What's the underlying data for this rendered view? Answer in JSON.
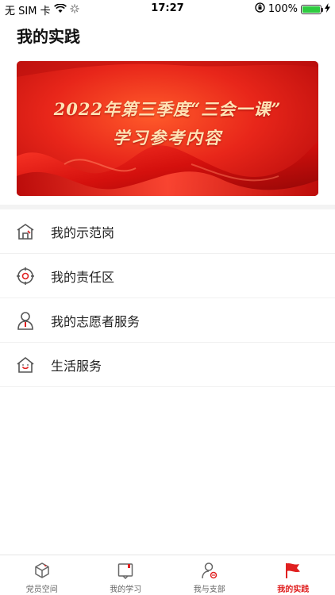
{
  "status_bar": {
    "carrier": "无 SIM 卡",
    "time": "17:27",
    "battery_percent": "100%",
    "battery_level": 1.0
  },
  "page": {
    "title": "我的实践"
  },
  "banner": {
    "line1": "2022年第三季度“三会一课”",
    "line2": "学习参考内容"
  },
  "menu": {
    "items": [
      {
        "label": "我的示范岗",
        "icon": "house-icon"
      },
      {
        "label": "我的责任区",
        "icon": "target-icon"
      },
      {
        "label": "我的志愿者服务",
        "icon": "volunteer-person-icon"
      },
      {
        "label": "生活服务",
        "icon": "smiling-house-icon"
      }
    ]
  },
  "tabbar": {
    "tabs": [
      {
        "label": "党员空间",
        "icon": "cube-icon",
        "active": false
      },
      {
        "label": "我的学习",
        "icon": "book-icon",
        "active": false
      },
      {
        "label": "我与支部",
        "icon": "member-icon",
        "active": false
      },
      {
        "label": "我的实践",
        "icon": "red-flag-icon",
        "active": true
      }
    ]
  },
  "colors": {
    "accent": "#e02020",
    "banner_red": "#d81e14",
    "banner_text": "#ffe3b5",
    "icon_gray": "#555555"
  }
}
